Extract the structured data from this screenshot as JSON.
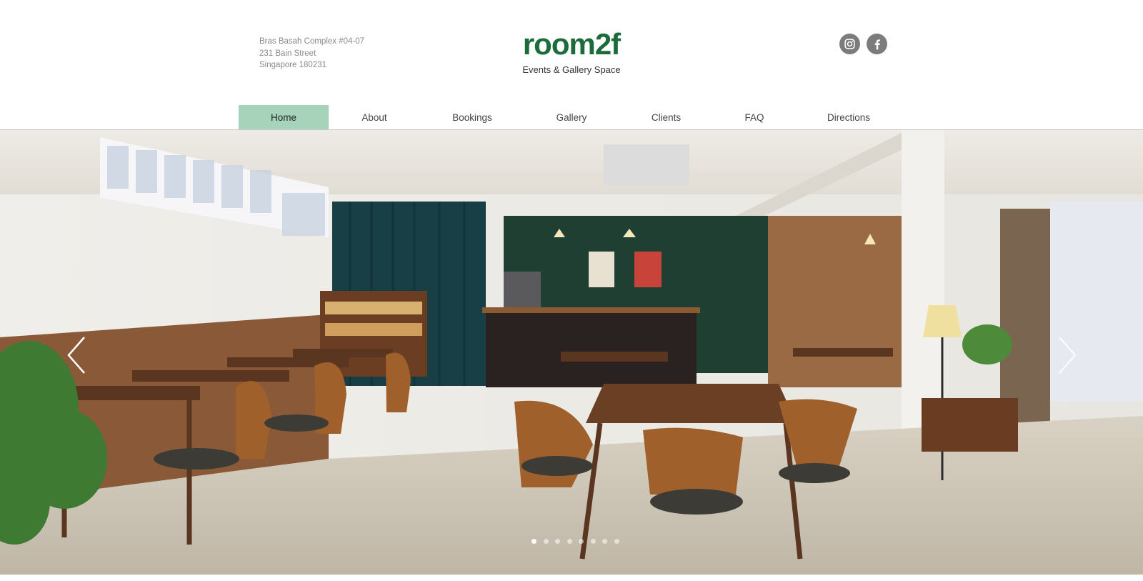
{
  "address": {
    "line1": "Bras Basah Complex #04-07",
    "line2": "231 Bain Street",
    "line3": "Singapore 180231"
  },
  "logo": {
    "text": "room2f",
    "tagline": "Events & Gallery Space",
    "color": "#1c6b3a"
  },
  "social": [
    {
      "icon": "instagram-icon"
    },
    {
      "icon": "facebook-icon"
    }
  ],
  "nav": {
    "active_color": "#a6d3b9",
    "items": [
      {
        "label": "Home",
        "active": true
      },
      {
        "label": "About"
      },
      {
        "label": "Bookings"
      },
      {
        "label": "Gallery"
      },
      {
        "label": "Clients"
      },
      {
        "label": "FAQ"
      },
      {
        "label": "Directions"
      }
    ]
  },
  "slideshow": {
    "slide_count": 8,
    "current_slide": 1,
    "prev_icon": "chevron-left-icon",
    "next_icon": "chevron-right-icon"
  }
}
